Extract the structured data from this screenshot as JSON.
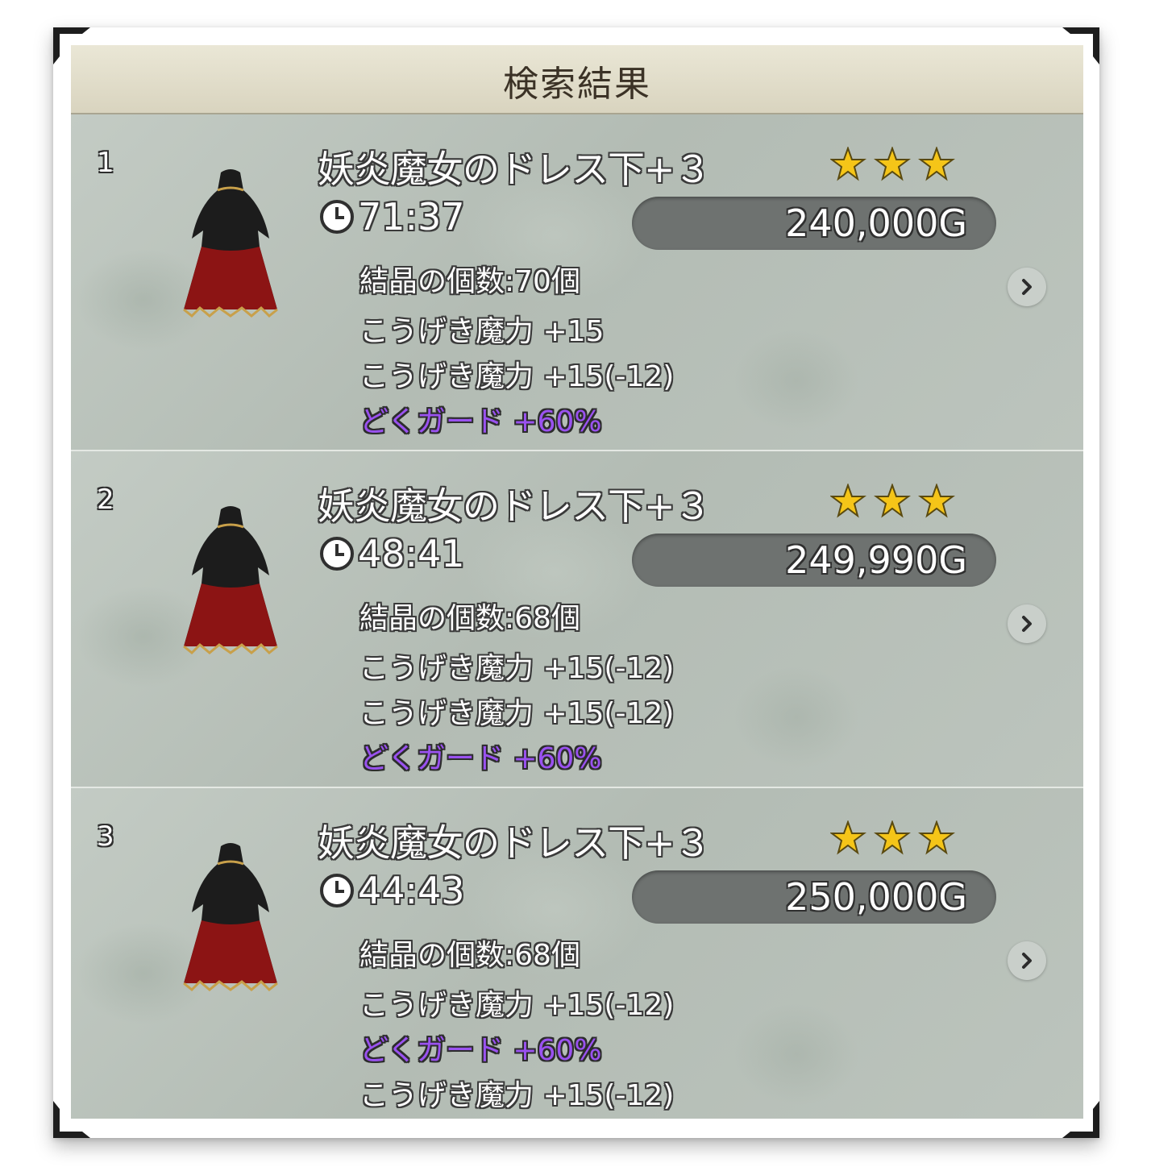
{
  "header": {
    "title": "検索結果"
  },
  "results": [
    {
      "rank": "1",
      "name": "妖炎魔女のドレス下+３",
      "stars": 3,
      "time": "71:37",
      "price": "240,000G",
      "crystals": "結晶の個数:70個",
      "stats": [
        {
          "text": "こうげき魔力 +15",
          "special": false
        },
        {
          "text": "こうげき魔力 +15(-12)",
          "special": false
        },
        {
          "text": "どくガード +60%",
          "special": true
        }
      ]
    },
    {
      "rank": "2",
      "name": "妖炎魔女のドレス下+３",
      "stars": 3,
      "time": "48:41",
      "price": "249,990G",
      "crystals": "結晶の個数:68個",
      "stats": [
        {
          "text": "こうげき魔力 +15(-12)",
          "special": false
        },
        {
          "text": "こうげき魔力 +15(-12)",
          "special": false
        },
        {
          "text": "どくガード +60%",
          "special": true
        }
      ]
    },
    {
      "rank": "3",
      "name": "妖炎魔女のドレス下+３",
      "stars": 3,
      "time": "44:43",
      "price": "250,000G",
      "crystals": "結晶の個数:68個",
      "stats": [
        {
          "text": "こうげき魔力 +15(-12)",
          "special": false
        },
        {
          "text": "どくガード +60%",
          "special": true
        },
        {
          "text": "こうげき魔力 +15(-12)",
          "special": false
        }
      ]
    }
  ],
  "colors": {
    "special_stat": "#9a52f0",
    "price_pill": "#6e7270",
    "star": "#f5c518"
  },
  "icons": {
    "item": "dress-icon",
    "time": "clock-icon",
    "detail": "chevron-right-icon",
    "rating": "star-icon"
  }
}
